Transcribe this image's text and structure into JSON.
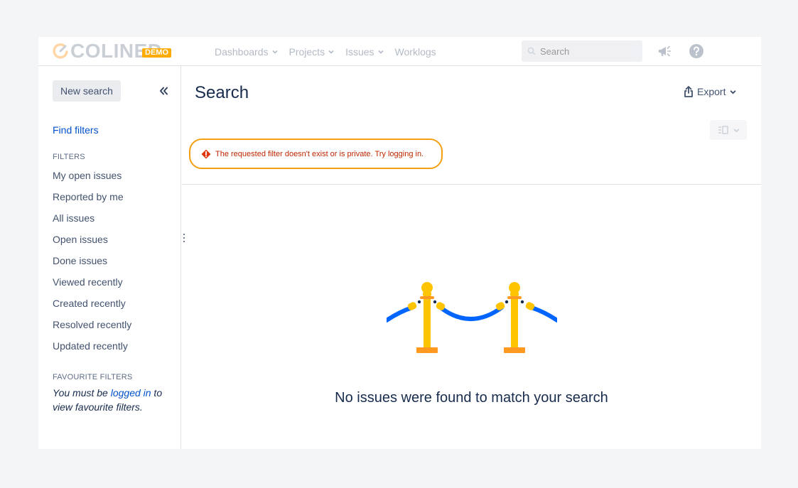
{
  "nav": {
    "logo_text": "COLINED",
    "logo_badge": "DEMO",
    "items": [
      {
        "label": "Dashboards"
      },
      {
        "label": "Projects"
      },
      {
        "label": "Issues"
      },
      {
        "label": "Worklogs"
      }
    ],
    "search_placeholder": "Search",
    "icons": [
      "colined-logo-icon",
      "chevron-down-icon",
      "search-icon",
      "megaphone-icon",
      "help-icon"
    ]
  },
  "sidebar": {
    "new_search_label": "New search",
    "find_filters_label": "Find filters",
    "filters_heading": "FILTERS",
    "filters": [
      {
        "label": "My open issues"
      },
      {
        "label": "Reported by me"
      },
      {
        "label": "All issues"
      },
      {
        "label": "Open issues"
      },
      {
        "label": "Done issues"
      },
      {
        "label": "Viewed recently"
      },
      {
        "label": "Created recently"
      },
      {
        "label": "Resolved recently"
      },
      {
        "label": "Updated recently"
      }
    ],
    "favourite_heading": "FAVOURITE FILTERS",
    "favourite_note_before": "You must be ",
    "favourite_note_link": "logged in",
    "favourite_note_after": " to view favourite filters."
  },
  "main": {
    "title": "Search",
    "export_label": "Export",
    "error_message": "The requested filter doesn't exist or is private. Try logging in.",
    "empty_message": "No issues were found to match your search"
  },
  "colors": {
    "link": "#0052cc",
    "error": "#bf2600",
    "error_outline": "#f2a011",
    "illustration_gold": "#ffc400",
    "illustration_rope": "#0065ff"
  }
}
